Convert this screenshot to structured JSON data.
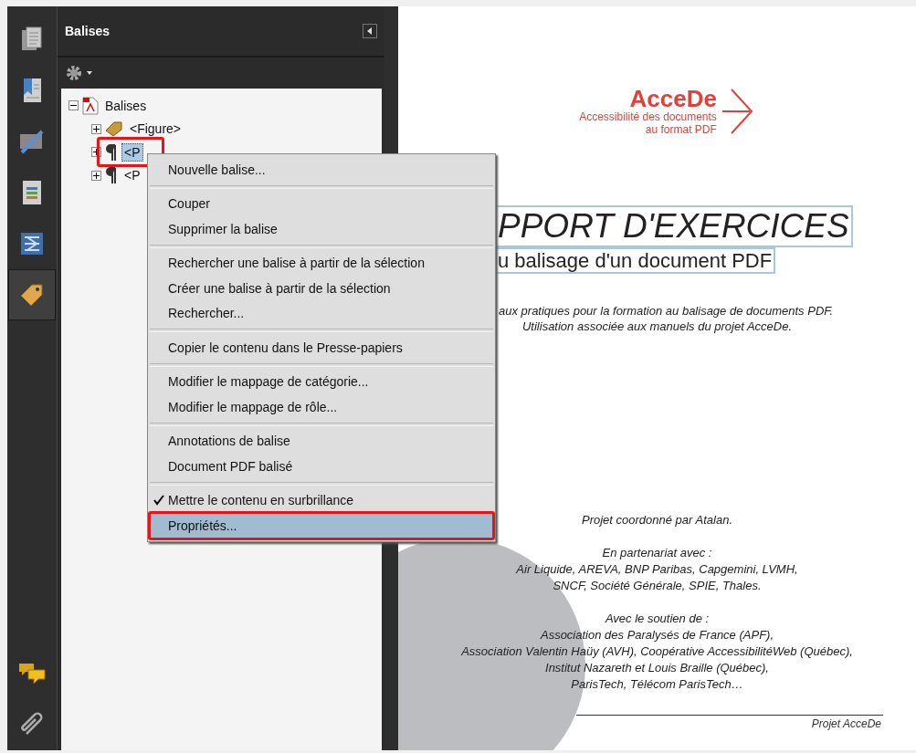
{
  "sidebar_tabs": {
    "top": [
      {
        "kind": "pages",
        "selected": false
      },
      {
        "kind": "bookmarks",
        "selected": false
      },
      {
        "kind": "signatures",
        "selected": false
      },
      {
        "kind": "content",
        "selected": false
      },
      {
        "kind": "order",
        "selected": false
      },
      {
        "kind": "tags",
        "selected": true
      }
    ],
    "bottom": [
      {
        "kind": "comments",
        "selected": false
      },
      {
        "kind": "attachments",
        "selected": false
      }
    ]
  },
  "panel": {
    "title": "Balises"
  },
  "tree": [
    {
      "label": "Balises",
      "kind": "pdf",
      "expanded": true,
      "selected": false,
      "annotated": false,
      "children": [
        {
          "label": "<Figure>",
          "kind": "tag",
          "expanded": false,
          "selected": false,
          "annotated": false
        },
        {
          "label": "<P",
          "kind": "paragraph",
          "expanded": false,
          "selected": true,
          "annotated": true
        },
        {
          "label": "<P",
          "kind": "paragraph",
          "expanded": false,
          "selected": false,
          "annotated": false
        }
      ]
    }
  ],
  "context_menu": {
    "groups": [
      [
        {
          "label": "Nouvelle balise...",
          "checked": false,
          "selected": false,
          "annotated": false
        }
      ],
      [
        {
          "label": "Couper",
          "checked": false,
          "selected": false,
          "annotated": false
        },
        {
          "label": "Supprimer la balise",
          "checked": false,
          "selected": false,
          "annotated": false
        }
      ],
      [
        {
          "label": "Rechercher une balise à partir de la sélection",
          "checked": false,
          "selected": false,
          "annotated": false
        },
        {
          "label": "Créer une balise à partir de la sélection",
          "checked": false,
          "selected": false,
          "annotated": false
        },
        {
          "label": "Rechercher...",
          "checked": false,
          "selected": false,
          "annotated": false
        }
      ],
      [
        {
          "label": "Copier le contenu dans le Presse-papiers",
          "checked": false,
          "selected": false,
          "annotated": false
        }
      ],
      [
        {
          "label": "Modifier le mappage de catégorie...",
          "checked": false,
          "selected": false,
          "annotated": false
        },
        {
          "label": "Modifier le mappage de rôle...",
          "checked": false,
          "selected": false,
          "annotated": false
        }
      ],
      [
        {
          "label": "Annotations de balise",
          "checked": false,
          "selected": false,
          "annotated": false
        },
        {
          "label": "Document PDF balisé",
          "checked": false,
          "selected": false,
          "annotated": false
        }
      ],
      [
        {
          "label": "Mettre le contenu en surbrillance",
          "checked": true,
          "selected": false,
          "annotated": false
        },
        {
          "label": "Propriétés...",
          "checked": false,
          "selected": true,
          "annotated": true
        }
      ]
    ]
  },
  "document": {
    "logo": {
      "name": "AcceDe",
      "tagline": [
        "Accessibilité des documents",
        "au format PDF"
      ]
    },
    "title": "PPORT D'EXERCICES",
    "subtitle": "u balisage d'un document PDF",
    "intro": [
      "aux pratiques pour la formation au balisage de documents PDF.",
      "Utilisation associée aux manuels du projet AcceDe."
    ],
    "credits": [
      [
        "Projet coordonné par Atalan."
      ],
      [
        "En partenariat avec :",
        "Air Liquide, AREVA, BNP Paribas, Capgemini, LVMH,",
        "SNCF, Société Générale, SPIE, Thales."
      ],
      [
        "Avec le soutien de :",
        "Association des Paralysés de France (APF),",
        "Association Valentin Haüy (AVH), Coopérative AccessibilitéWeb (Québec),",
        "Institut Nazareth et Louis Braille (Québec),",
        "ParisTech, Télécom ParisTech…"
      ]
    ],
    "footer": "Projet AcceDe"
  }
}
